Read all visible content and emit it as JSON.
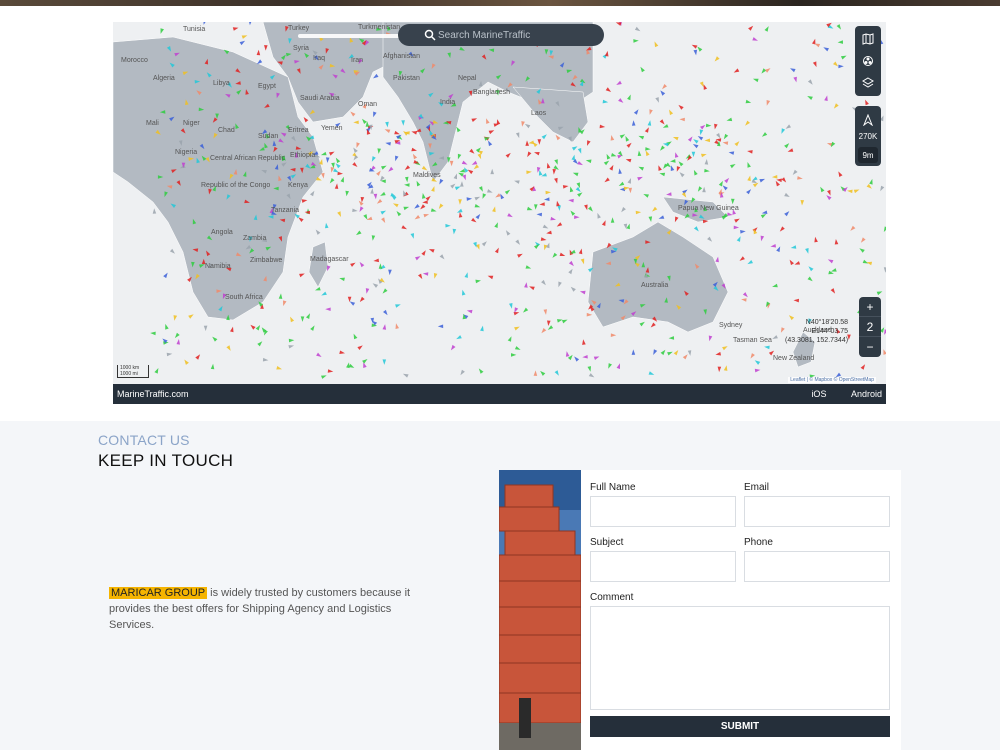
{
  "map": {
    "search_placeholder": "Search MarineTraffic",
    "scale_label": "270K",
    "time_label": "9m",
    "zoom_level": "2",
    "zoom_in": "+",
    "zoom_out": "−",
    "coords_line1": "N40°18'20.58",
    "coords_line2": "E144°03.75",
    "coords_line3": "(43.3081, 152.7344)",
    "scalebar_km": "1000 km",
    "scalebar_mi": "1000 mi",
    "attribution": "Leaflet | © Mapbox © OpenStreetMap",
    "footer_brand": "MarineTraffic.com",
    "footer_ios": "iOS",
    "footer_android": "Android",
    "place_names": [
      "Turkey",
      "Turkmenistan",
      "Tunisia",
      "Syria",
      "Iraq",
      "Iran",
      "Afghanistan",
      "Morocco",
      "Algeria",
      "Libya",
      "Egypt",
      "Saudi Arabia",
      "Pakistan",
      "Nepal",
      "India",
      "Bangladesh",
      "Oman",
      "Yemen",
      "Mali",
      "Niger",
      "Chad",
      "Sudan",
      "Eritrea",
      "Ethiopia",
      "Nigeria",
      "Central African Republic",
      "Republic of the Congo",
      "Kenya",
      "Tanzania",
      "Angola",
      "Zambia",
      "Zimbabwe",
      "Namibia",
      "Madagascar",
      "South Africa",
      "Laos",
      "Maldives",
      "Papua New Guinea",
      "Australia",
      "New Zealand",
      "Tasman Sea",
      "Sydney",
      "Auckland"
    ]
  },
  "contact": {
    "kicker": "CONTACT US",
    "heading": "KEEP IN TOUCH",
    "brand": "MARICAR GROUP",
    "blurb": " is widely trusted by customers because it provides the best offers for Shipping Agency and Logistics Services.",
    "form": {
      "full_name_label": "Full Name",
      "email_label": "Email",
      "subject_label": "Subject",
      "phone_label": "Phone",
      "comment_label": "Comment",
      "submit_label": "SUBMIT"
    }
  }
}
